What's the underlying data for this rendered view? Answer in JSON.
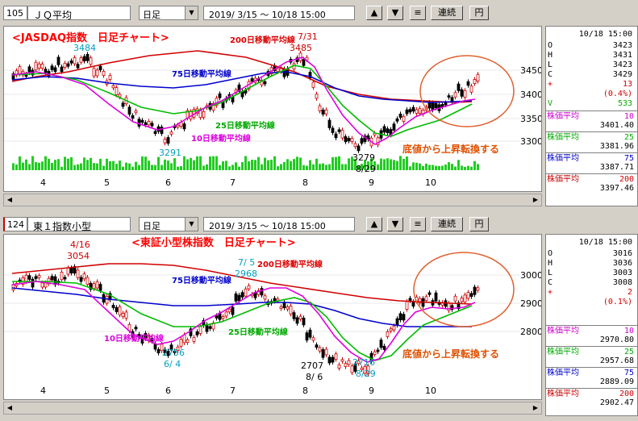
{
  "panels": [
    {
      "code": "105",
      "name": "ＪＱ平均",
      "period": "日足",
      "range": "2019/ 3/15 ～ 10/18 15:00",
      "btn_up": "▲",
      "btn_down": "▼",
      "btn_menu": "≡",
      "btn_cont": "連続",
      "btn_yen": "円",
      "title": "<JASDAQ指数　日足チャート>",
      "ma200": "200日移動平均線",
      "ma75": "75日移動平均線",
      "ma25": "25日移動平均線",
      "ma10": "10日移動平均線",
      "note": "底値から上昇転換する",
      "ann": [
        "3484",
        "7/31",
        "3485",
        "3291",
        "3279",
        "8/29"
      ],
      "yticks": [
        "3450",
        "3400",
        "3350",
        "3300"
      ],
      "months": [
        "4",
        "5",
        "6",
        "7",
        "8",
        "9",
        "10"
      ],
      "side": {
        "datetime": "10/18 15:00",
        "ohlc": [
          [
            "O",
            "3423"
          ],
          [
            "H",
            "3431"
          ],
          [
            "L",
            "3423"
          ],
          [
            "C",
            "3429"
          ],
          [
            "+",
            "13"
          ],
          [
            "",
            "(0.4%)"
          ],
          [
            "V",
            "533"
          ]
        ],
        "ma": [
          [
            "株価平均",
            "10",
            "3401.40",
            "#cc00cc"
          ],
          [
            "株価平均",
            "25",
            "3381.96",
            "#00aa00"
          ],
          [
            "株価平均",
            "75",
            "3387.71",
            "#0000cc"
          ],
          [
            "株価平均",
            "200",
            "3397.46",
            "#cc0000"
          ]
        ]
      }
    },
    {
      "code": "124",
      "name": "東１指数小型",
      "period": "日足",
      "range": "2019/ 3/15 ～ 10/18 15:00",
      "btn_up": "▲",
      "btn_down": "▼",
      "btn_menu": "≡",
      "btn_cont": "連続",
      "btn_yen": "円",
      "title": "<東証小型株指数　日足チャート>",
      "ma200": "200日移動平均線",
      "ma75": "75日移動平均線",
      "ma25": "25日移動平均線",
      "ma10": "10日移動平均線",
      "note": "底値から上昇転換する",
      "ann": [
        "4/16",
        "3054",
        "7/ 5",
        "2968",
        "2756",
        "6/ 4",
        "2707",
        "8/ 6",
        "2716",
        "8/29"
      ],
      "yticks": [
        "3000",
        "2900",
        "2800"
      ],
      "months": [
        "4",
        "5",
        "6",
        "7",
        "8",
        "9",
        "10"
      ],
      "side": {
        "datetime": "10/18 15:00",
        "ohlc": [
          [
            "O",
            "3016"
          ],
          [
            "H",
            "3036"
          ],
          [
            "L",
            "3003"
          ],
          [
            "C",
            "3008"
          ],
          [
            "+",
            "2"
          ],
          [
            "",
            "(0.1%)"
          ]
        ],
        "ma": [
          [
            "株価平均",
            "10",
            "2970.80",
            "#cc00cc"
          ],
          [
            "株価平均",
            "25",
            "2957.68",
            "#00aa00"
          ],
          [
            "株価平均",
            "75",
            "2889.09",
            "#0000cc"
          ],
          [
            "株価平均",
            "200",
            "2902.47",
            "#cc0000"
          ]
        ]
      }
    }
  ]
}
